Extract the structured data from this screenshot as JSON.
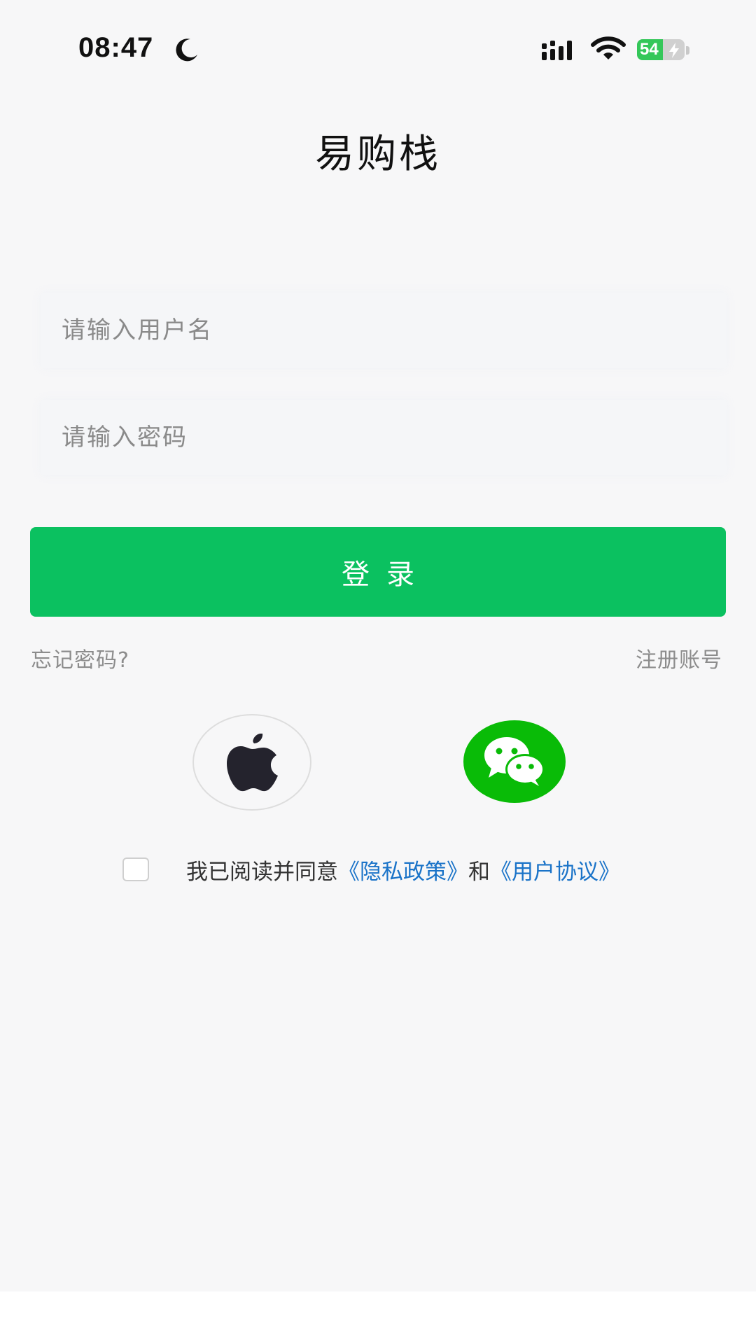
{
  "status_bar": {
    "time": "08:47",
    "battery": "54",
    "battery_level": 0.54
  },
  "app": {
    "title": "易购栈"
  },
  "form": {
    "username_placeholder": "请输入用户名",
    "password_placeholder": "请输入密码",
    "login_label": "登录",
    "forgot_label": "忘记密码?",
    "register_label": "注册账号"
  },
  "social": {
    "apple_icon": "apple-icon",
    "wechat_icon": "wechat-icon",
    "wechat_color": "#09bb07"
  },
  "agreement": {
    "prefix": "我已阅读并同意",
    "privacy": "《隐私政策》",
    "and": "和",
    "terms": "《用户协议》",
    "checked": false
  },
  "colors": {
    "accent": "#0bc160",
    "link": "#1a73c8",
    "battery": "#34c759"
  }
}
